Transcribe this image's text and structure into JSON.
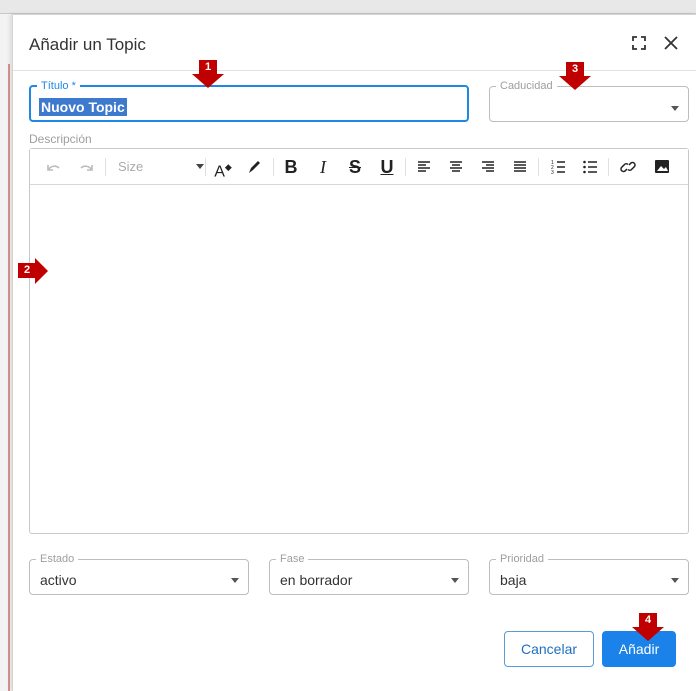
{
  "dialog": {
    "title": "Añadir un Topic",
    "expand_icon": "expand-icon",
    "close_icon": "close-icon"
  },
  "form": {
    "titulo": {
      "label": "Título *",
      "value": "Nuovo Topic"
    },
    "caducidad": {
      "label": "Caducidad",
      "value": ""
    },
    "descripcion": {
      "label": "Descripción"
    },
    "estado": {
      "label": "Estado",
      "value": "activo"
    },
    "fase": {
      "label": "Fase",
      "value": "en borrador"
    },
    "prioridad": {
      "label": "Prioridad",
      "value": "baja"
    }
  },
  "toolbar": {
    "undo_icon": "undo-icon",
    "redo_icon": "redo-icon",
    "size_placeholder": "Size",
    "text_color_icon": "text-color-icon",
    "highlight_icon": "highlight-pen-icon",
    "bold_label": "B",
    "italic_label": "I",
    "strike_label": "S",
    "underline_label": "U",
    "align_left_icon": "align-left-icon",
    "align_center_icon": "align-center-icon",
    "align_right_icon": "align-right-icon",
    "align_justify_icon": "align-justify-icon",
    "ordered_list_icon": "ordered-list-icon",
    "bullet_list_icon": "bullet-list-icon",
    "link_icon": "link-icon",
    "image_icon": "image-icon"
  },
  "actions": {
    "cancel_label": "Cancelar",
    "add_label": "Añadir"
  },
  "annotations": {
    "marker1": "1",
    "marker2": "2",
    "marker3": "3",
    "marker4": "4"
  },
  "colors": {
    "primary": "#1a82e8",
    "focus": "#1e88e5",
    "annotation": "#c00000",
    "selection": "#3d79cc"
  }
}
